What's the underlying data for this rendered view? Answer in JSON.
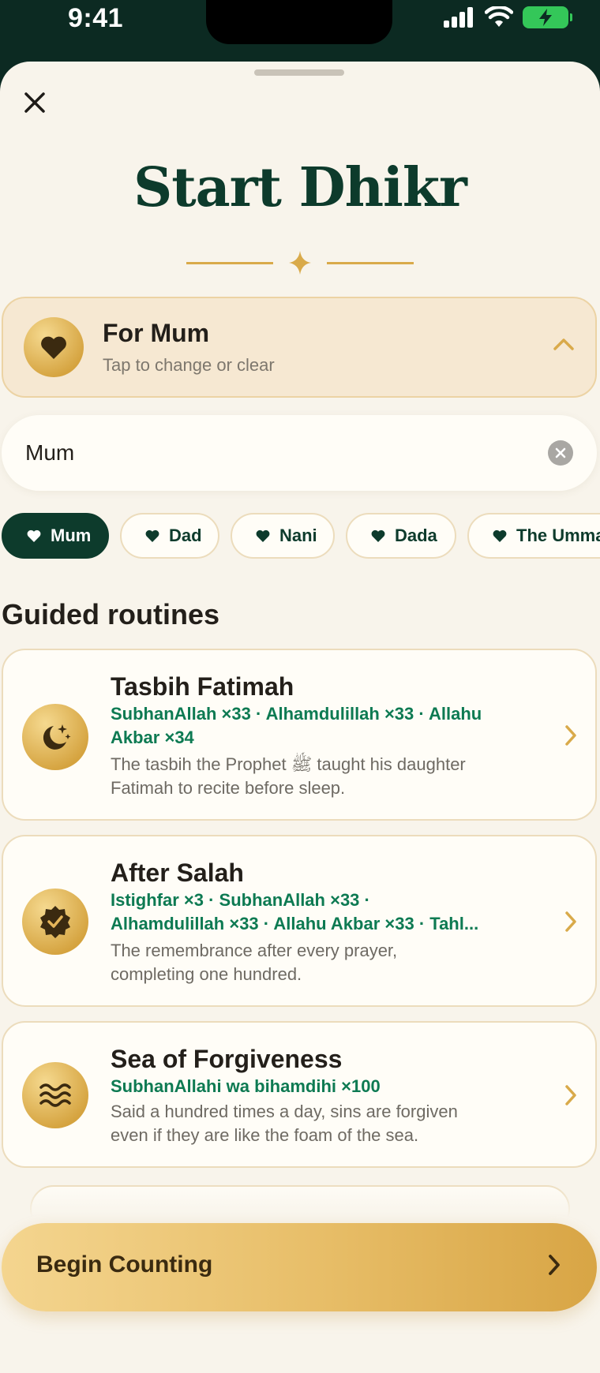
{
  "status_bar": {
    "time": "9:41"
  },
  "sheet": {
    "title": "Start Dhikr"
  },
  "dedication": {
    "title": "For Mum",
    "subtitle": "Tap to change or clear"
  },
  "name_input": {
    "value": "Mum"
  },
  "chips": [
    {
      "label": "Mum",
      "active": true
    },
    {
      "label": "Dad",
      "active": false
    },
    {
      "label": "Nani",
      "active": false
    },
    {
      "label": "Dada",
      "active": false
    },
    {
      "label": "The Ummah",
      "active": false
    }
  ],
  "section": {
    "title": "Guided routines"
  },
  "routines": [
    {
      "title": "Tasbih Fatimah",
      "recipe": "SubhanAllah ×33 · Alhamdulillah ×33 · Allahu\nAkbar ×34",
      "description": "The tasbih the Prophet ﷺ taught his daughter\nFatimah to recite before sleep.",
      "icon": "moon-stars-icon"
    },
    {
      "title": "After Salah",
      "recipe": "Istighfar ×3 · SubhanAllah ×33 ·\nAlhamdulillah ×33 · Allahu Akbar ×33 · Tahl...",
      "description": "The remembrance after every prayer,\ncompleting one hundred.",
      "icon": "seal-check-icon"
    },
    {
      "title": "Sea of Forgiveness",
      "recipe": "SubhanAllahi wa bihamdihi ×100",
      "description": "Said a hundred times a day, sins are forgiven\neven if they are like the foam of the sea.",
      "icon": "waves-icon"
    }
  ],
  "cta": {
    "label": "Begin Counting"
  },
  "colors": {
    "primary_green": "#0d3b2c",
    "accent_gold": "#d9aa4a",
    "recipe_green": "#0d7a52",
    "background": "#f8f4eb"
  }
}
